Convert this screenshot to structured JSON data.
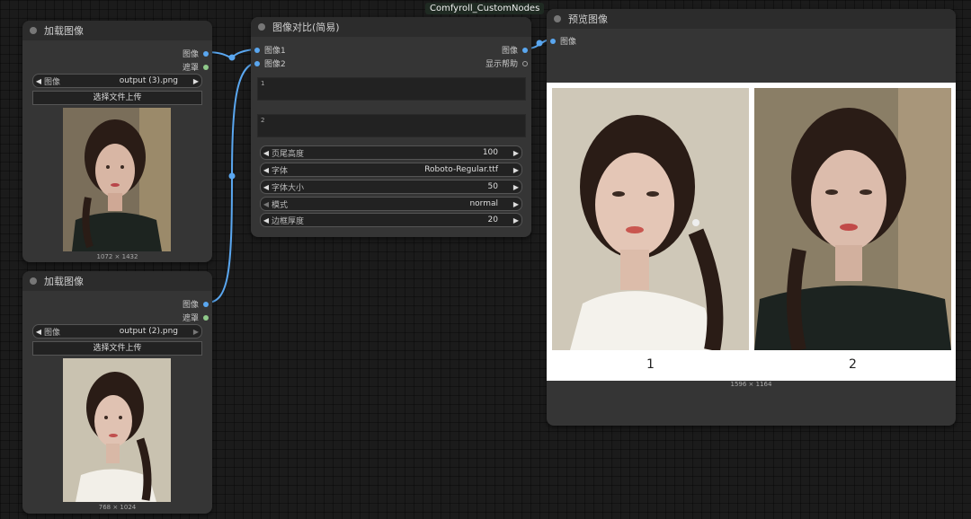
{
  "badge": "Comfyroll_CustomNodes",
  "load1": {
    "title": "加载图像",
    "out_image": "图像",
    "out_mask": "遮罩",
    "image_label": "图像",
    "image_value": "output (3).png",
    "upload_label": "选择文件上传",
    "caption": "1072 × 1432"
  },
  "load2": {
    "title": "加载图像",
    "out_image": "图像",
    "out_mask": "遮罩",
    "image_label": "图像",
    "image_value": "output (2).png",
    "upload_label": "选择文件上传",
    "caption": "768 × 1024"
  },
  "compare": {
    "title": "图像对比(简易)",
    "in1": "图像1",
    "in2": "图像2",
    "out_image": "图像",
    "out_help": "显示帮助",
    "text1": "1",
    "text2": "2",
    "widgets": [
      {
        "label": "页尾高度",
        "value": "100"
      },
      {
        "label": "字体",
        "value": "Roboto-Regular.ttf"
      },
      {
        "label": "字体大小",
        "value": "50"
      },
      {
        "label": "模式",
        "value": "normal"
      },
      {
        "label": "边框厚度",
        "value": "20"
      }
    ]
  },
  "preview": {
    "title": "预览图像",
    "in_image": "图像",
    "label_left": "1",
    "label_right": "2",
    "caption": "1596 × 1164"
  },
  "colors": {
    "link": "#5aa7f0",
    "node_bg": "#353535",
    "canvas": "#1b1b1b"
  }
}
